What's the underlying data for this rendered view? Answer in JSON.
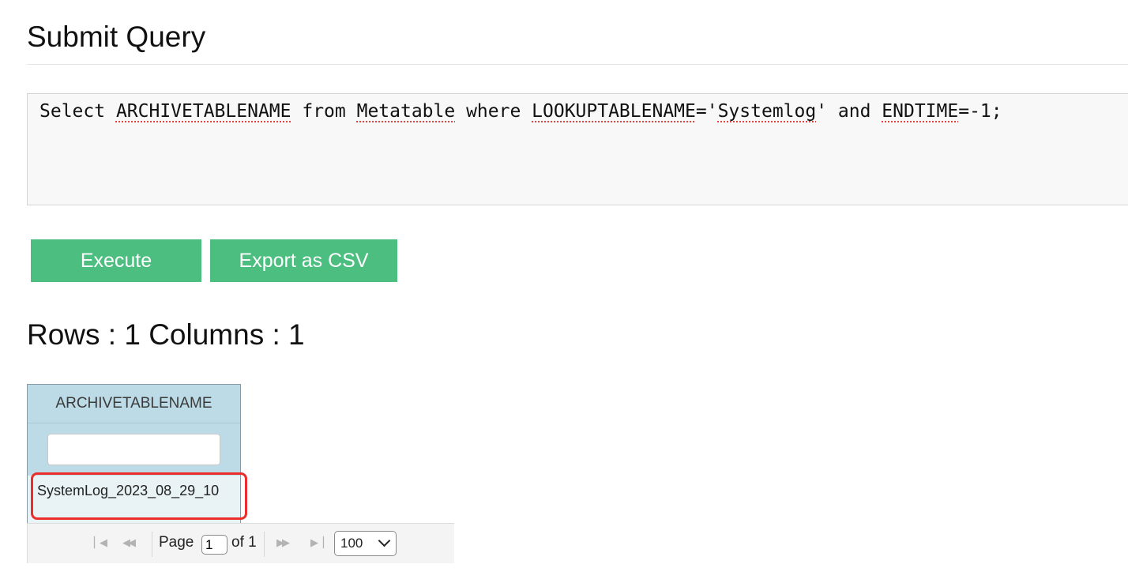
{
  "page_title": "Submit Query",
  "query": {
    "segments": [
      {
        "text": "Select ",
        "spell": false
      },
      {
        "text": "ARCHIVETABLENAME",
        "spell": true
      },
      {
        "text": " from ",
        "spell": false
      },
      {
        "text": "Metatable",
        "spell": true
      },
      {
        "text": " where ",
        "spell": false
      },
      {
        "text": "LOOKUPTABLENAME",
        "spell": true
      },
      {
        "text": "='",
        "spell": false
      },
      {
        "text": "Systemlog",
        "spell": true
      },
      {
        "text": "' and ",
        "spell": false
      },
      {
        "text": "ENDTIME",
        "spell": true
      },
      {
        "text": "=-1;",
        "spell": false
      }
    ]
  },
  "buttons": {
    "execute": "Execute",
    "export_csv": "Export as CSV"
  },
  "colors": {
    "button_green": "#4cbe80",
    "grid_header": "#bcdbe7",
    "highlight_red": "#ec2d2d"
  },
  "summary": "Rows : 1 Columns : 1",
  "grid": {
    "columns": [
      "ARCHIVETABLENAME"
    ],
    "filter_value": "",
    "rows": [
      [
        "SystemLog_2023_08_29_10"
      ]
    ]
  },
  "pager": {
    "page_label": "Page",
    "current_page": "1",
    "of_label": "of 1",
    "page_size": "100",
    "icons": [
      "first-page-icon",
      "prev-page-icon",
      "next-page-icon",
      "last-page-icon"
    ]
  }
}
